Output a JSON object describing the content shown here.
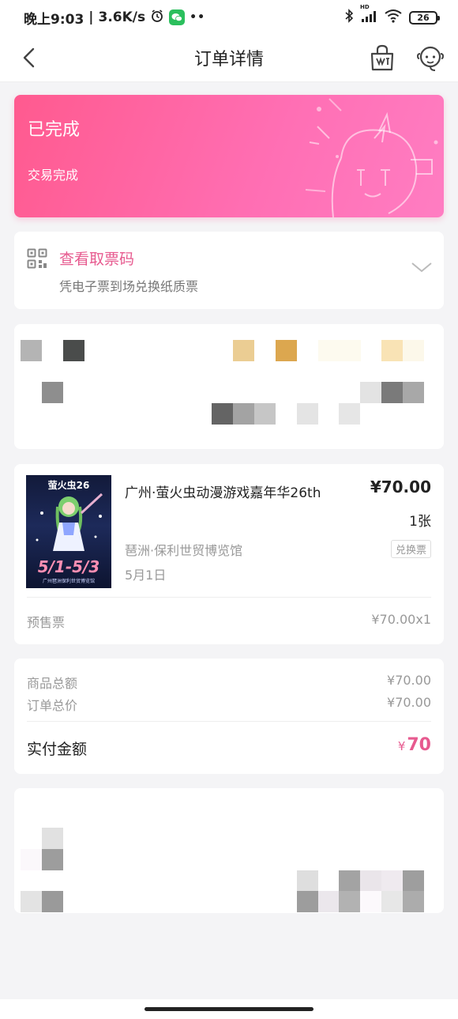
{
  "status_bar": {
    "time": "晚上9:03",
    "speed": "3.6K/s",
    "network": "HD",
    "battery": "26"
  },
  "nav": {
    "title": "订单详情"
  },
  "order_status": {
    "title": "已完成",
    "subtitle": "交易完成"
  },
  "ticket_code": {
    "title": "查看取票码",
    "subtitle": "凭电子票到场兑换纸质票"
  },
  "item": {
    "poster_title": "萤火虫26",
    "poster_date": "5/1-5/3",
    "poster_foot": "广州琶洲保利世贸博览馆",
    "name": "广州·萤火虫动漫游戏嘉年华26th",
    "price": "¥70.00",
    "quantity": "1张",
    "venue": "琶洲·保利世贸博览馆",
    "tag": "兑换票",
    "date": "5月1日",
    "ticket_type": "预售票",
    "ticket_price": "¥70.00x1"
  },
  "totals": {
    "goods_label": "商品总额",
    "goods_value": "¥70.00",
    "order_label": "订单总价",
    "order_value": "¥70.00",
    "paid_label": "实付金额",
    "paid_currency": "¥",
    "paid_value": "70"
  },
  "colors": {
    "accent": "#e75a8f",
    "status_gradient_start": "#ff5a8f",
    "status_gradient_end": "#ff7dc2"
  }
}
